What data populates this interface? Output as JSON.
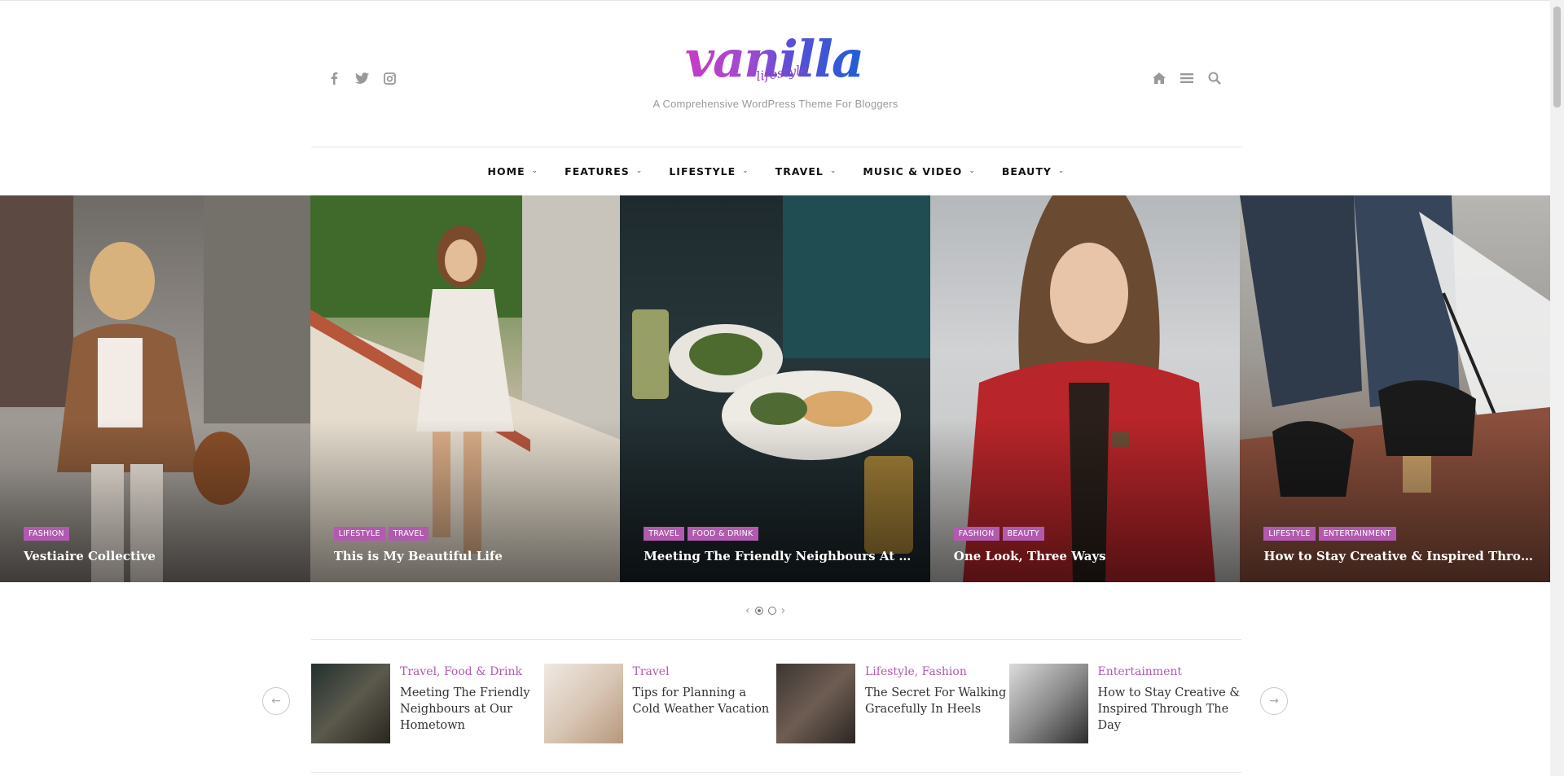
{
  "header": {
    "logo_text": "vanilla",
    "logo_sub": "lifestyle",
    "tagline": "A Comprehensive WordPress Theme For Bloggers",
    "social_icons": [
      "facebook-icon",
      "twitter-icon",
      "instagram-icon"
    ],
    "tool_icons": [
      "home-icon",
      "menu-icon",
      "search-icon"
    ]
  },
  "nav": {
    "items": [
      {
        "label": "HOME"
      },
      {
        "label": "FEATURES"
      },
      {
        "label": "LIFESTYLE"
      },
      {
        "label": "TRAVEL"
      },
      {
        "label": "MUSIC & VIDEO"
      },
      {
        "label": "BEAUTY"
      }
    ]
  },
  "slider": {
    "slides": [
      {
        "categories": [
          "FASHION"
        ],
        "title": "Vestiaire Collective"
      },
      {
        "categories": [
          "LIFESTYLE",
          "TRAVEL"
        ],
        "title": "This is My Beautiful Life"
      },
      {
        "categories": [
          "TRAVEL",
          "FOOD & DRINK"
        ],
        "title": "Meeting The Friendly Neighbours At Our..."
      },
      {
        "categories": [
          "FASHION",
          "BEAUTY"
        ],
        "title": "One Look, Three Ways"
      },
      {
        "categories": [
          "LIFESTYLE",
          "ENTERTAINMENT"
        ],
        "title": "How to Stay Creative & Inspired Through..."
      }
    ],
    "prev_glyph": "‹",
    "next_glyph": "›",
    "pages": 2,
    "active_page": 1
  },
  "carousel": {
    "prev_glyph": "←",
    "next_glyph": "→",
    "posts": [
      {
        "category": "Travel, Food & Drink",
        "title": "Meeting The Friendly Neighbours at Our Hometown"
      },
      {
        "category": "Travel",
        "title": "Tips for Planning a Cold Weather Vacation"
      },
      {
        "category": "Lifestyle, Fashion",
        "title": "The Secret For Walking Gracefully In Heels"
      },
      {
        "category": "Entertainment",
        "title": "How to Stay Creative & Inspired Through The Day"
      }
    ]
  },
  "colors": {
    "accent": "#b15ab0",
    "logo_gradient": [
      "#c63cc3",
      "#5a4fd6",
      "#1e5fd7"
    ]
  }
}
